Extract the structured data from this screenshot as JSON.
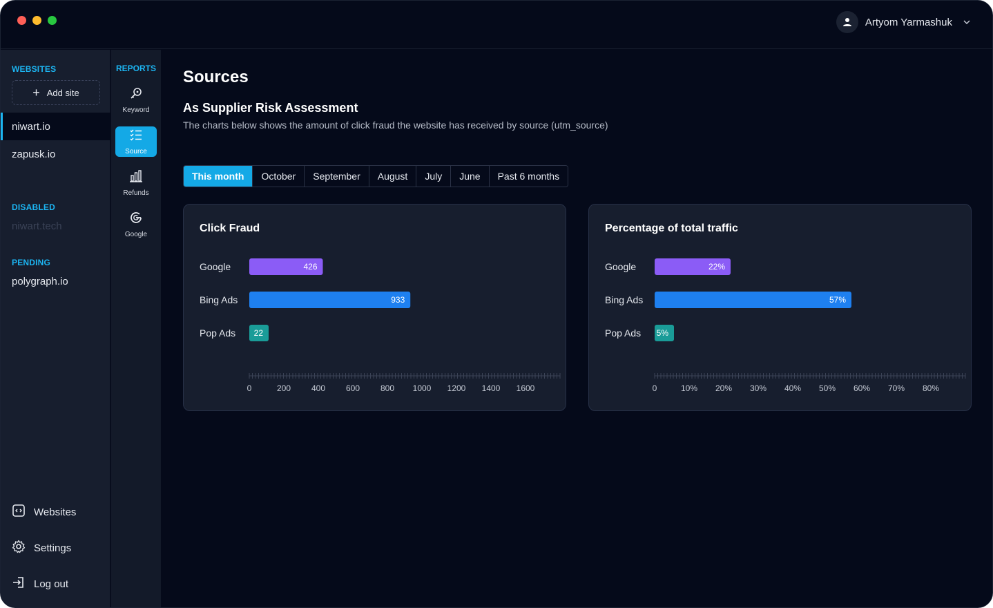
{
  "user": {
    "name": "Artyom Yarmashuk"
  },
  "sidebar": {
    "websites_title": "WEBSITES",
    "add_site_label": "Add site",
    "sites": [
      {
        "label": "niwart.io",
        "active": true
      },
      {
        "label": "zapusk.io",
        "active": false
      }
    ],
    "disabled_title": "DISABLED",
    "disabled_sites": [
      {
        "label": "niwart.tech"
      }
    ],
    "pending_title": "PENDING",
    "pending_sites": [
      {
        "label": "polygraph.io"
      }
    ],
    "bottom": [
      {
        "label": "Websites",
        "icon": "code-window-icon"
      },
      {
        "label": "Settings",
        "icon": "gear-icon"
      },
      {
        "label": "Log out",
        "icon": "logout-icon"
      }
    ]
  },
  "reports": {
    "title": "REPORTS",
    "items": [
      {
        "label": "Keyword",
        "icon": "key-icon"
      },
      {
        "label": "Source",
        "icon": "list-icon",
        "active": true
      },
      {
        "label": "Refunds",
        "icon": "bar-chart-icon"
      },
      {
        "label": "Google",
        "icon": "google-icon"
      }
    ]
  },
  "main": {
    "title": "Sources",
    "subtitle": "As Supplier Risk Assessment",
    "description": "The charts below shows the amount of click fraud the website has received by source (utm_source)",
    "tabs": [
      {
        "label": "This month",
        "active": true
      },
      {
        "label": "October"
      },
      {
        "label": "September"
      },
      {
        "label": "August"
      },
      {
        "label": "July"
      },
      {
        "label": "June"
      },
      {
        "label": "Past 6 months"
      }
    ]
  },
  "colors": {
    "accent": "#14a9e6",
    "google": "#8b5cf6",
    "bing": "#1e80f0",
    "pop": "#1a9c98"
  },
  "chart_data": [
    {
      "type": "bar",
      "orientation": "horizontal",
      "title": "Click Fraud",
      "categories": [
        "Google",
        "Bing Ads",
        "Pop Ads"
      ],
      "values": [
        426,
        933,
        22
      ],
      "value_labels": [
        "426",
        "933",
        "22"
      ],
      "colors": [
        "#8b5cf6",
        "#1e80f0",
        "#1a9c98"
      ],
      "xlim": [
        0,
        1800
      ],
      "ticks": [
        0,
        200,
        400,
        600,
        800,
        1000,
        1200,
        1400,
        1600
      ],
      "tick_labels": [
        "0",
        "200",
        "400",
        "600",
        "800",
        "1000",
        "1200",
        "1400",
        "1600"
      ],
      "grid": false
    },
    {
      "type": "bar",
      "orientation": "horizontal",
      "title": "Percentage of total traffic",
      "categories": [
        "Google",
        "Bing Ads",
        "Pop Ads"
      ],
      "values": [
        22,
        57,
        5
      ],
      "value_labels": [
        "22%",
        "57%",
        "5%"
      ],
      "colors": [
        "#8b5cf6",
        "#1e80f0",
        "#1a9c98"
      ],
      "xlim": [
        0,
        90
      ],
      "ticks": [
        0,
        10,
        20,
        30,
        40,
        50,
        60,
        70,
        80
      ],
      "tick_labels": [
        "0",
        "10%",
        "20%",
        "30%",
        "40%",
        "50%",
        "60%",
        "70%",
        "80%"
      ],
      "grid": false
    }
  ]
}
